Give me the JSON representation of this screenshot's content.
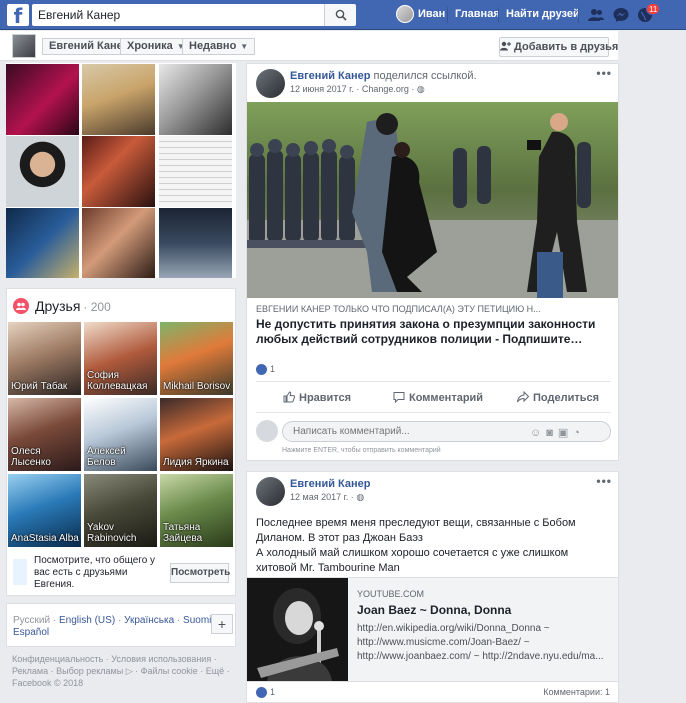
{
  "topbar": {
    "logo": "f",
    "search_value": "Евгений Канер",
    "nav_user": "Иван",
    "nav_home": "Главная",
    "nav_find_friends": "Найти друзей",
    "notif_count": "11",
    "accent": "#4267b2"
  },
  "subheader": {
    "profile_name": "Евгений Канер",
    "timeline": "Хроника",
    "recent": "Недавно",
    "add_friend": "Добавить в друзья"
  },
  "friends": {
    "title": "Друзья",
    "count": "· 200",
    "items": [
      {
        "name": "Юрий Табак"
      },
      {
        "name": "София Коллевацкая"
      },
      {
        "name": "Mikhail Borisov"
      },
      {
        "name": "Олеся Лысенко"
      },
      {
        "name": "Алексей Белов"
      },
      {
        "name": "Лидия Яркина"
      },
      {
        "name": "AnaStasia Alba"
      },
      {
        "name": "Yakov Rabinovich"
      },
      {
        "name": "Татьяна Зайцева"
      }
    ],
    "compare_text": "Посмотрите, что общего у вас есть с друзьями Евгения.",
    "compare_button": "Посмотреть"
  },
  "languages": {
    "current": "Русский",
    "sep": "·",
    "items": [
      "English (US)",
      "Українська",
      "Suomi",
      "Español"
    ],
    "plus": "+"
  },
  "footer": {
    "privacy": "Конфиденциальность",
    "terms": "Условия использования",
    "ads": "Реклама",
    "ad_choices": "Выбор рекламы",
    "cookies": "Файлы cookie",
    "more": "Ещё",
    "copyright": "Facebook © 2018"
  },
  "post1": {
    "author": "Евгений Канер",
    "action": "поделился ссылкой.",
    "date": "12 июня 2017 г. ·",
    "source": "Change.org ·",
    "link_domain": "ЕВГЕНИИ КАНЕР ТОЛЬКО ЧТО ПОДПИСАЛ(А) ЭТУ ПЕТИЦИЮ Н...",
    "link_title": "Не допустить принятия закона о презумпции законности любых действий сотрудников полиции - Подпишите…",
    "reactions": "1",
    "like": "Нравится",
    "comment": "Комментарий",
    "share": "Поделиться",
    "comment_placeholder": "Написать комментарий...",
    "comment_hint": "Нажмите ENTER, чтобы отправить комментарий"
  },
  "post2": {
    "author": "Евгений Канер",
    "date": "12 мая 2017 г. ·",
    "text_1": "Последнее время меня преследуют вещи, связанные с Бобом Диланом. В этот раз Джоан Баэз",
    "text_2": "А холодный май слишком хорошо сочетается с уже слишком хитовой Mr. Tambourine Man",
    "link_domain": "YOUTUBE.COM",
    "link_title": "Joan Baez ~ Donna, Donna",
    "link_desc": "http://en.wikipedia.org/wiki/Donna_Donna ~ http://www.musicme.com/Joan-Baez/ ~ http://www.joanbaez.com/ ~ http://2ndave.nyu.edu/ma...",
    "reactions": "1",
    "comments": "Комментарии: 1"
  }
}
